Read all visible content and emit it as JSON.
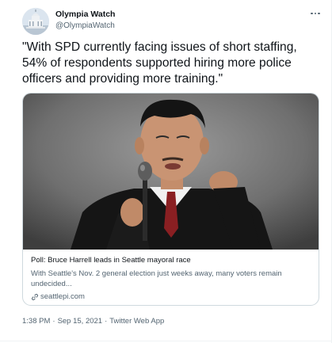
{
  "author": {
    "display_name": "Olympia Watch",
    "handle": "@OlympiaWatch",
    "avatar_icon": "capitol-building-avatar"
  },
  "menu_icon": "more-horizontal-icon",
  "tweet": {
    "text": "\"With SPD currently facing issues of short staffing, 54% of respondents supported hiring more police officers and providing more training.\""
  },
  "card": {
    "image_icon": "man-speaking-at-microphone-photo",
    "title": "Poll: Bruce Harrell leads in Seattle mayoral race",
    "description": "With Seattle's Nov. 2 general election just weeks away, many voters remain undecided...",
    "domain": "seattlepi.com",
    "domain_icon": "link-icon"
  },
  "meta": {
    "time": "1:38 PM",
    "separator": "·",
    "date": "Sep 15, 2021",
    "source": "Twitter Web App"
  },
  "colors": {
    "text_primary": "#0f1419",
    "text_secondary": "#536471",
    "border": "#cfd9de"
  }
}
